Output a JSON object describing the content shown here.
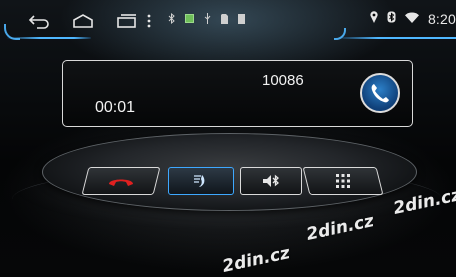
{
  "status_bar": {
    "clock": "8:20",
    "nav_icons": [
      "back-icon",
      "home-icon",
      "recent-apps-icon",
      "menu-dots-icon"
    ],
    "notification_icons": [
      "bluetooth-icon",
      "app-notification-icon",
      "usb-icon",
      "sd-card-icon",
      "storage-icon"
    ],
    "system_icons": [
      "location-icon",
      "bluetooth-connected-icon",
      "wifi-icon"
    ]
  },
  "call": {
    "number": "10086",
    "timer": "00:01"
  },
  "dock": {
    "buttons": [
      "hang-up",
      "handset",
      "bluetooth-audio",
      "keypad"
    ],
    "hangup_color": "#e02020",
    "accent": "#3ea8ff"
  },
  "watermark": {
    "text_1": "2din.cz",
    "text_2": "2din.cz",
    "text_3": "2din.cz"
  }
}
